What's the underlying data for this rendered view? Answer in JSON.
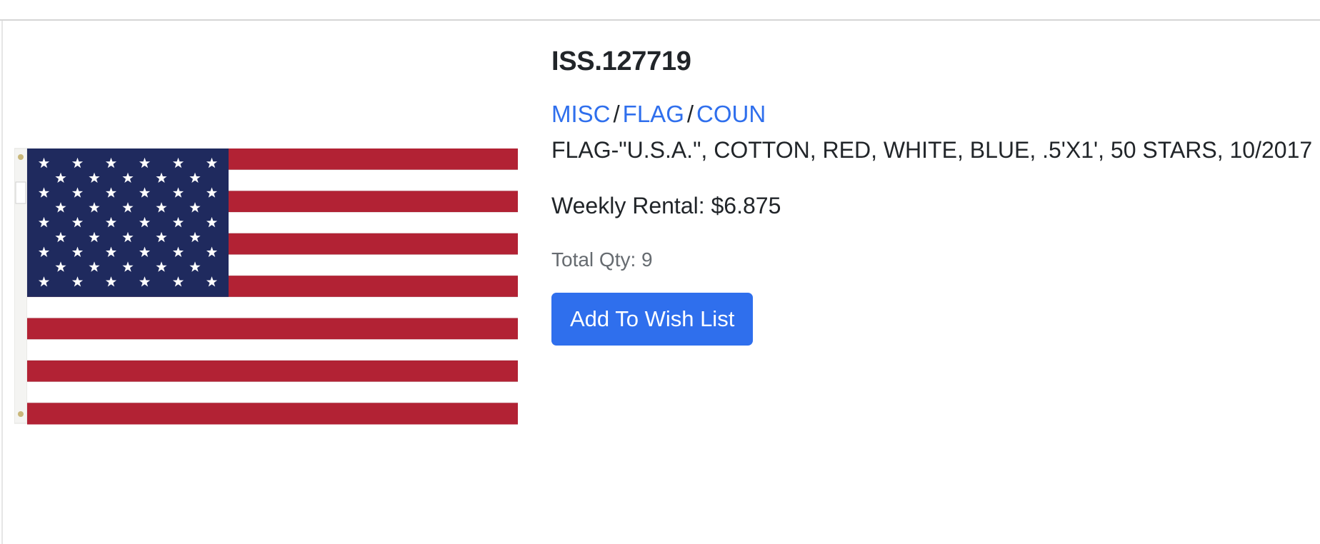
{
  "item": {
    "id": "ISS.127719",
    "breadcrumb": [
      "MISC",
      "FLAG",
      "COUN"
    ],
    "breadcrumb_separator": "/",
    "description": "FLAG-\"U.S.A.\", COTTON, RED, WHITE, BLUE, .5'X1', 50 STARS, 10/2017",
    "rental": "Weekly Rental: $6.875",
    "total_qty": "Total Qty: 9"
  },
  "actions": {
    "wish_list_label": "Add To Wish List"
  },
  "image": {
    "subject": "us-flag-icon"
  },
  "colors": {
    "link": "#2f6fed",
    "button_bg": "#2f6fed",
    "button_text": "#ffffff",
    "flag_red": "#b22234",
    "flag_blue": "#1f2a5e",
    "flag_white": "#ffffff"
  }
}
